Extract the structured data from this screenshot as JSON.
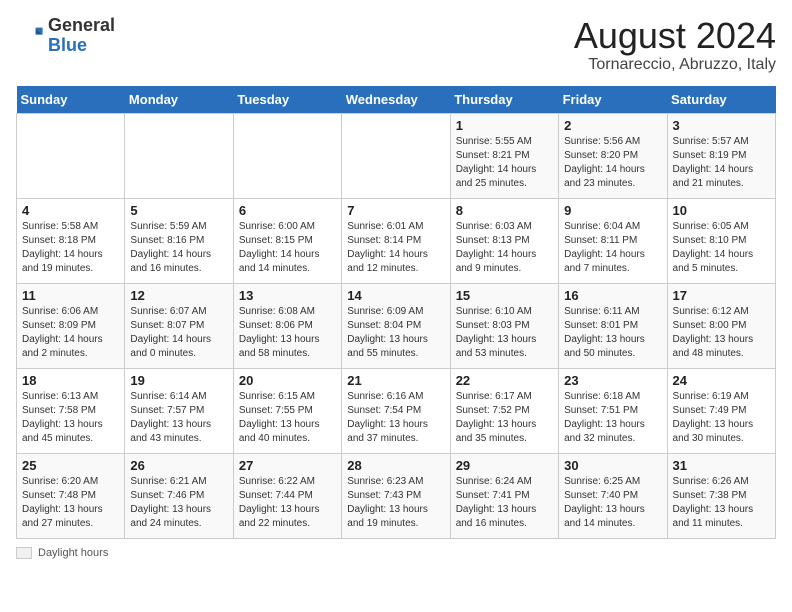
{
  "header": {
    "logo_general": "General",
    "logo_blue": "Blue",
    "month_year": "August 2024",
    "location": "Tornareccio, Abruzzo, Italy"
  },
  "days_of_week": [
    "Sunday",
    "Monday",
    "Tuesday",
    "Wednesday",
    "Thursday",
    "Friday",
    "Saturday"
  ],
  "weeks": [
    [
      {
        "day": "",
        "info": ""
      },
      {
        "day": "",
        "info": ""
      },
      {
        "day": "",
        "info": ""
      },
      {
        "day": "",
        "info": ""
      },
      {
        "day": "1",
        "info": "Sunrise: 5:55 AM\nSunset: 8:21 PM\nDaylight: 14 hours and 25 minutes."
      },
      {
        "day": "2",
        "info": "Sunrise: 5:56 AM\nSunset: 8:20 PM\nDaylight: 14 hours and 23 minutes."
      },
      {
        "day": "3",
        "info": "Sunrise: 5:57 AM\nSunset: 8:19 PM\nDaylight: 14 hours and 21 minutes."
      }
    ],
    [
      {
        "day": "4",
        "info": "Sunrise: 5:58 AM\nSunset: 8:18 PM\nDaylight: 14 hours and 19 minutes."
      },
      {
        "day": "5",
        "info": "Sunrise: 5:59 AM\nSunset: 8:16 PM\nDaylight: 14 hours and 16 minutes."
      },
      {
        "day": "6",
        "info": "Sunrise: 6:00 AM\nSunset: 8:15 PM\nDaylight: 14 hours and 14 minutes."
      },
      {
        "day": "7",
        "info": "Sunrise: 6:01 AM\nSunset: 8:14 PM\nDaylight: 14 hours and 12 minutes."
      },
      {
        "day": "8",
        "info": "Sunrise: 6:03 AM\nSunset: 8:13 PM\nDaylight: 14 hours and 9 minutes."
      },
      {
        "day": "9",
        "info": "Sunrise: 6:04 AM\nSunset: 8:11 PM\nDaylight: 14 hours and 7 minutes."
      },
      {
        "day": "10",
        "info": "Sunrise: 6:05 AM\nSunset: 8:10 PM\nDaylight: 14 hours and 5 minutes."
      }
    ],
    [
      {
        "day": "11",
        "info": "Sunrise: 6:06 AM\nSunset: 8:09 PM\nDaylight: 14 hours and 2 minutes."
      },
      {
        "day": "12",
        "info": "Sunrise: 6:07 AM\nSunset: 8:07 PM\nDaylight: 14 hours and 0 minutes."
      },
      {
        "day": "13",
        "info": "Sunrise: 6:08 AM\nSunset: 8:06 PM\nDaylight: 13 hours and 58 minutes."
      },
      {
        "day": "14",
        "info": "Sunrise: 6:09 AM\nSunset: 8:04 PM\nDaylight: 13 hours and 55 minutes."
      },
      {
        "day": "15",
        "info": "Sunrise: 6:10 AM\nSunset: 8:03 PM\nDaylight: 13 hours and 53 minutes."
      },
      {
        "day": "16",
        "info": "Sunrise: 6:11 AM\nSunset: 8:01 PM\nDaylight: 13 hours and 50 minutes."
      },
      {
        "day": "17",
        "info": "Sunrise: 6:12 AM\nSunset: 8:00 PM\nDaylight: 13 hours and 48 minutes."
      }
    ],
    [
      {
        "day": "18",
        "info": "Sunrise: 6:13 AM\nSunset: 7:58 PM\nDaylight: 13 hours and 45 minutes."
      },
      {
        "day": "19",
        "info": "Sunrise: 6:14 AM\nSunset: 7:57 PM\nDaylight: 13 hours and 43 minutes."
      },
      {
        "day": "20",
        "info": "Sunrise: 6:15 AM\nSunset: 7:55 PM\nDaylight: 13 hours and 40 minutes."
      },
      {
        "day": "21",
        "info": "Sunrise: 6:16 AM\nSunset: 7:54 PM\nDaylight: 13 hours and 37 minutes."
      },
      {
        "day": "22",
        "info": "Sunrise: 6:17 AM\nSunset: 7:52 PM\nDaylight: 13 hours and 35 minutes."
      },
      {
        "day": "23",
        "info": "Sunrise: 6:18 AM\nSunset: 7:51 PM\nDaylight: 13 hours and 32 minutes."
      },
      {
        "day": "24",
        "info": "Sunrise: 6:19 AM\nSunset: 7:49 PM\nDaylight: 13 hours and 30 minutes."
      }
    ],
    [
      {
        "day": "25",
        "info": "Sunrise: 6:20 AM\nSunset: 7:48 PM\nDaylight: 13 hours and 27 minutes."
      },
      {
        "day": "26",
        "info": "Sunrise: 6:21 AM\nSunset: 7:46 PM\nDaylight: 13 hours and 24 minutes."
      },
      {
        "day": "27",
        "info": "Sunrise: 6:22 AM\nSunset: 7:44 PM\nDaylight: 13 hours and 22 minutes."
      },
      {
        "day": "28",
        "info": "Sunrise: 6:23 AM\nSunset: 7:43 PM\nDaylight: 13 hours and 19 minutes."
      },
      {
        "day": "29",
        "info": "Sunrise: 6:24 AM\nSunset: 7:41 PM\nDaylight: 13 hours and 16 minutes."
      },
      {
        "day": "30",
        "info": "Sunrise: 6:25 AM\nSunset: 7:40 PM\nDaylight: 13 hours and 14 minutes."
      },
      {
        "day": "31",
        "info": "Sunrise: 6:26 AM\nSunset: 7:38 PM\nDaylight: 13 hours and 11 minutes."
      }
    ]
  ],
  "footer": {
    "box_label": "Daylight hours"
  }
}
